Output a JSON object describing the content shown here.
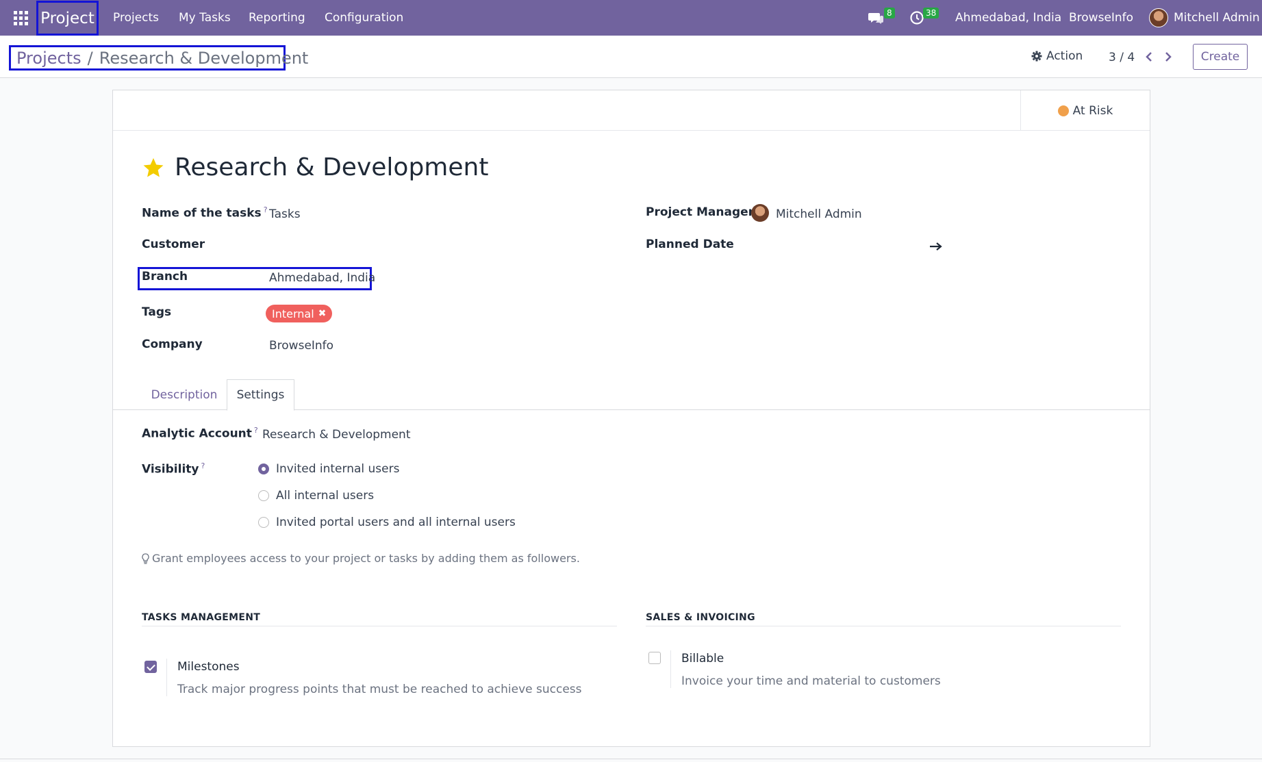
{
  "navbar": {
    "app_name": "Project",
    "menu": [
      "Projects",
      "My Tasks",
      "Reporting",
      "Configuration"
    ],
    "messages_count": "8",
    "activities_count": "38",
    "branch": "Ahmedabad, India",
    "company": "BrowseInfo",
    "user": "Mitchell Admin"
  },
  "breadcrumb": {
    "parent": "Projects",
    "separator": "/",
    "current": "Research & Development"
  },
  "control": {
    "action_label": "Action",
    "pager": "3 / 4",
    "create_label": "Create"
  },
  "status": {
    "label": "At Risk",
    "color": "#f0a04b"
  },
  "form": {
    "title": "Research & Development",
    "name_of_tasks_label": "Name of the tasks",
    "name_of_tasks_value": "Tasks",
    "customer_label": "Customer",
    "branch_label": "Branch",
    "branch_value": "Ahmedabad, India",
    "tags_label": "Tags",
    "tag": "Internal",
    "company_label": "Company",
    "company_value": "BrowseInfo",
    "project_manager_label": "Project Manager",
    "project_manager_value": "Mitchell Admin",
    "planned_date_label": "Planned Date",
    "help_mark": "?"
  },
  "tabs": [
    "Description",
    "Settings"
  ],
  "settings": {
    "analytic_account_label": "Analytic Account",
    "analytic_account_value": "Research & Development",
    "visibility_label": "Visibility",
    "visibility_options": [
      "Invited internal users",
      "All internal users",
      "Invited portal users and all internal users"
    ],
    "visibility_selected": 0,
    "hint": "Grant employees access to your project or tasks by adding them as followers.",
    "tasks_management_title": "TASKS MANAGEMENT",
    "sales_invoicing_title": "SALES & INVOICING",
    "milestones_title": "Milestones",
    "milestones_desc": "Track major progress points that must be reached to achieve success",
    "milestones_checked": true,
    "billable_title": "Billable",
    "billable_desc": "Invoice your time and material to customers",
    "billable_checked": false
  },
  "colors": {
    "brand": "#71639e",
    "tag": "#f0605d",
    "badge": "#28a745"
  }
}
